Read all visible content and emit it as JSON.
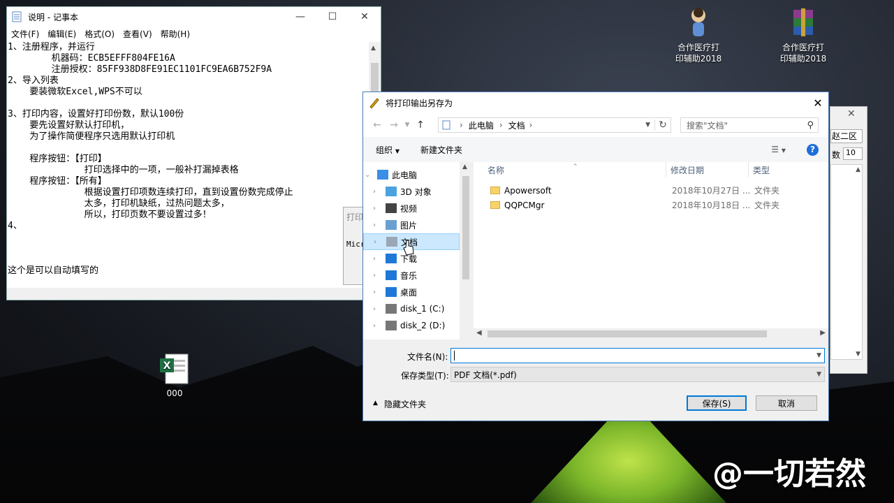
{
  "desktop": {
    "icons": [
      {
        "label": "合作医疗打\n印辅助2018"
      },
      {
        "label": "合作医疗打\n印辅助2018"
      },
      {
        "label": "000"
      }
    ],
    "watermark": "@一切若然"
  },
  "notepad": {
    "title": "说明 - 记事本",
    "menu": [
      "文件(F)",
      "编辑(E)",
      "格式(O)",
      "查看(V)",
      "帮助(H)"
    ],
    "lines": [
      "1、注册程序，并运行",
      "        机器码：ECB5EFFF804FE16A",
      "        注册授权：85FF938D8FE91EC1101FC9EA6B752F9A",
      "2、导入列表",
      "    要装微软Excel,WPS不可以",
      "",
      "3、打印内容，设置好打印份数，默认100份",
      "    要先设置好默认打印机，",
      "    为了操作简便程序只选用默认打印机",
      "",
      "    程序按钮：【打印】",
      "              打印选择中的一项，一般补打漏掉表格",
      "    程序按钮：【所有】",
      "              根据设置打印项数连续打印，直到设置份数完成停止",
      "              太多，打印机缺纸，过热问题太多，",
      "              所以，打印页数不要设置过多！",
      "4、",
      "",
      "",
      "",
      "这个是可以自动填写的"
    ]
  },
  "mini_dialog_left": {
    "title": "打印",
    "text": "Micr"
  },
  "mini_dialog_right": {
    "field1": "赵二区",
    "label2": "数",
    "field2": "10"
  },
  "save_dialog": {
    "title": "将打印输出另存为",
    "address": {
      "crumbs": [
        "此电脑",
        "文档"
      ]
    },
    "search_placeholder": "搜索\"文档\"",
    "toolbar": {
      "organize": "组织",
      "new_folder": "新建文件夹"
    },
    "tree": [
      {
        "label": "此电脑",
        "icon": "pc-icon"
      },
      {
        "label": "3D 对象",
        "icon": "cube-icon"
      },
      {
        "label": "视频",
        "icon": "video-icon"
      },
      {
        "label": "图片",
        "icon": "picture-icon"
      },
      {
        "label": "文档",
        "icon": "document-icon",
        "selected": true
      },
      {
        "label": "下载",
        "icon": "download-icon"
      },
      {
        "label": "音乐",
        "icon": "music-icon"
      },
      {
        "label": "桌面",
        "icon": "desktop-icon"
      },
      {
        "label": "disk_1 (C:)",
        "icon": "drive-icon"
      },
      {
        "label": "disk_2 (D:)",
        "icon": "drive-icon"
      }
    ],
    "columns": {
      "name": "名称",
      "date": "修改日期",
      "type": "类型"
    },
    "files": [
      {
        "name": "Apowersoft",
        "date": "2018年10月27日 ...",
        "type": "文件夹"
      },
      {
        "name": "QQPCMgr",
        "date": "2018年10月18日 ...",
        "type": "文件夹"
      }
    ],
    "filename_label": "文件名(N):",
    "filename_value": "",
    "filetype_label": "保存类型(T):",
    "filetype_value": "PDF 文档(*.pdf)",
    "hide_folders": "隐藏文件夹",
    "save_button": "保存(S)",
    "cancel_button": "取消"
  }
}
